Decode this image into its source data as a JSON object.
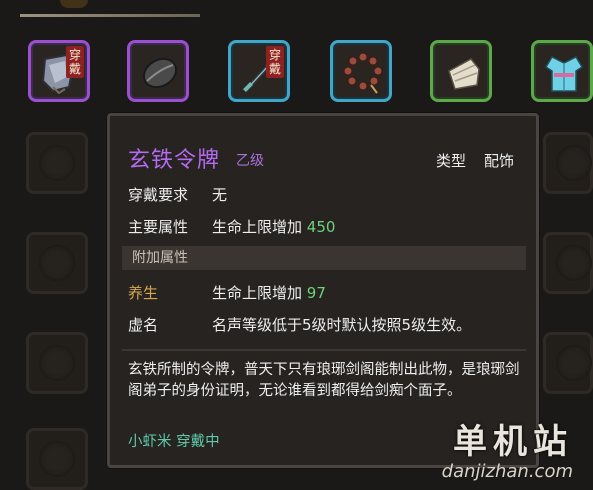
{
  "slots": {
    "equipped_badge": "穿戴",
    "items": [
      {
        "name": "token",
        "rarity": "purple",
        "equipped": true
      },
      {
        "name": "dark-shell",
        "rarity": "purple",
        "equipped": false
      },
      {
        "name": "sword",
        "rarity": "blue",
        "equipped": true
      },
      {
        "name": "prayer-beads",
        "rarity": "blue",
        "equipped": false
      },
      {
        "name": "bandage",
        "rarity": "green",
        "equipped": false
      },
      {
        "name": "robe",
        "rarity": "green",
        "equipped": false
      }
    ]
  },
  "tooltip": {
    "title": "玄铁令牌",
    "grade": "乙级",
    "type_label": "类型",
    "type_value": "配饰",
    "requirement_label": "穿戴要求",
    "requirement_value": "无",
    "main_attr_label": "主要属性",
    "main_attr_text": "生命上限增加",
    "main_attr_num": "450",
    "extra_header": "附加属性",
    "extra1_label": "养生",
    "extra1_text": "生命上限增加",
    "extra1_num": "97",
    "extra2_label": "虚名",
    "extra2_text": "名声等级低于5级时默认按照5级生效。",
    "description": "玄铁所制的令牌，普天下只有琅琊剑阁能制出此物，是琅琊剑阁弟子的身份证明，无论谁看到都得给剑痴个面子。",
    "equipped_by": "小虾米 穿戴中"
  },
  "watermark": {
    "cn": "单机站",
    "en": "danjizhan.com"
  },
  "colors": {
    "purple": "#9b4fd1",
    "blue": "#3fa7c9",
    "green": "#5ca84b",
    "title": "#b56af0",
    "number": "#6fd17a"
  }
}
